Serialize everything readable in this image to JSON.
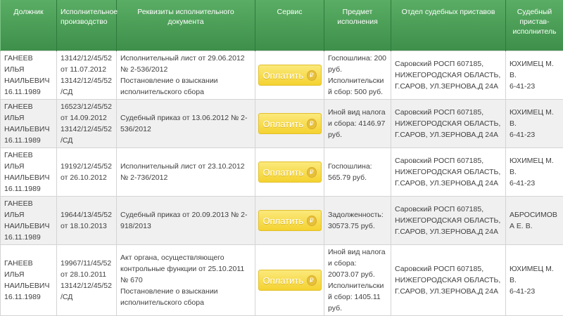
{
  "headers": {
    "debtor": "Должник",
    "proceeding": "Исполнительное производство",
    "document": "Реквизиты исполнительного документа",
    "service": "Сервис",
    "subject": "Предмет исполнения",
    "department": "Отдел судебных приставов",
    "bailiff": "Судебный пристав-исполнитель"
  },
  "pay_label": "Оплатить",
  "rub_symbol": "₽",
  "rows": [
    {
      "debtor": "ГАНЕЕВ ИЛЬЯ НАИЛЬЕВИЧ 16.11.1989",
      "proceeding": "13142/12/45/52 от 11.07.2012 13142/12/45/52/СД",
      "document": "Исполнительный лист от 29.06.2012 № 2-536/2012",
      "document_extra": "Постановление о взыскании исполнительского сбора",
      "subject": "Госпошлина: 200 руб. Исполнительский сбор: 500 руб.",
      "department": "Саровский РОСП 607185, НИЖЕГОРОДСКАЯ ОБЛАСТЬ, Г.САРОВ, УЛ.ЗЕРНОВА,Д 24А",
      "bailiff": "ЮХИМЕЦ М. В.",
      "phone": "6-41-23"
    },
    {
      "debtor": "ГАНЕЕВ ИЛЬЯ НАИЛЬЕВИЧ 16.11.1989",
      "proceeding": "16523/12/45/52 от 14.09.2012 13142/12/45/52/СД",
      "document": "Судебный приказ от 13.06.2012 № 2-536/2012",
      "document_extra": "",
      "subject": "Иной вид налога и сбора: 4146.97 руб.",
      "department": "Саровский РОСП 607185, НИЖЕГОРОДСКАЯ ОБЛАСТЬ, Г.САРОВ, УЛ.ЗЕРНОВА,Д 24А",
      "bailiff": "ЮХИМЕЦ М. В.",
      "phone": "6-41-23"
    },
    {
      "debtor": "ГАНЕЕВ ИЛЬЯ НАИЛЬЕВИЧ 16.11.1989",
      "proceeding": "19192/12/45/52 от 26.10.2012",
      "document": "Исполнительный лист от 23.10.2012 № 2-736/2012",
      "document_extra": "",
      "subject": "Госпошлина: 565.79 руб.",
      "department": "Саровский РОСП 607185, НИЖЕГОРОДСКАЯ ОБЛАСТЬ, Г.САРОВ, УЛ.ЗЕРНОВА,Д 24А",
      "bailiff": "ЮХИМЕЦ М. В.",
      "phone": "6-41-23"
    },
    {
      "debtor": "ГАНЕЕВ ИЛЬЯ НАИЛЬЕВИЧ 16.11.1989",
      "proceeding": "19644/13/45/52 от 18.10.2013",
      "document": "Судебный приказ от 20.09.2013 № 2-918/2013",
      "document_extra": "",
      "subject": "Задолженность: 30573.75 руб.",
      "department": "Саровский РОСП 607185, НИЖЕГОРОДСКАЯ ОБЛАСТЬ, Г.САРОВ, УЛ.ЗЕРНОВА,Д 24А",
      "bailiff": "АБРОСИМОВА Е. В.",
      "phone": ""
    },
    {
      "debtor": "ГАНЕЕВ ИЛЬЯ НАИЛЬЕВИЧ 16.11.1989",
      "proceeding": "19967/11/45/52 от 28.10.2011 13142/12/45/52/СД",
      "document": "Акт органа, осуществляющего контрольные функции от 25.10.2011 № 670",
      "document_extra": "Постановление о взыскании исполнительского сбора",
      "subject": "Иной вид налога и сбора: 20073.07 руб. Исполнительский сбор: 1405.11 руб.",
      "department": "Саровский РОСП 607185, НИЖЕГОРОДСКАЯ ОБЛАСТЬ, Г.САРОВ, УЛ.ЗЕРНОВА,Д 24А",
      "bailiff": "ЮХИМЕЦ М. В.",
      "phone": "6-41-23"
    }
  ]
}
